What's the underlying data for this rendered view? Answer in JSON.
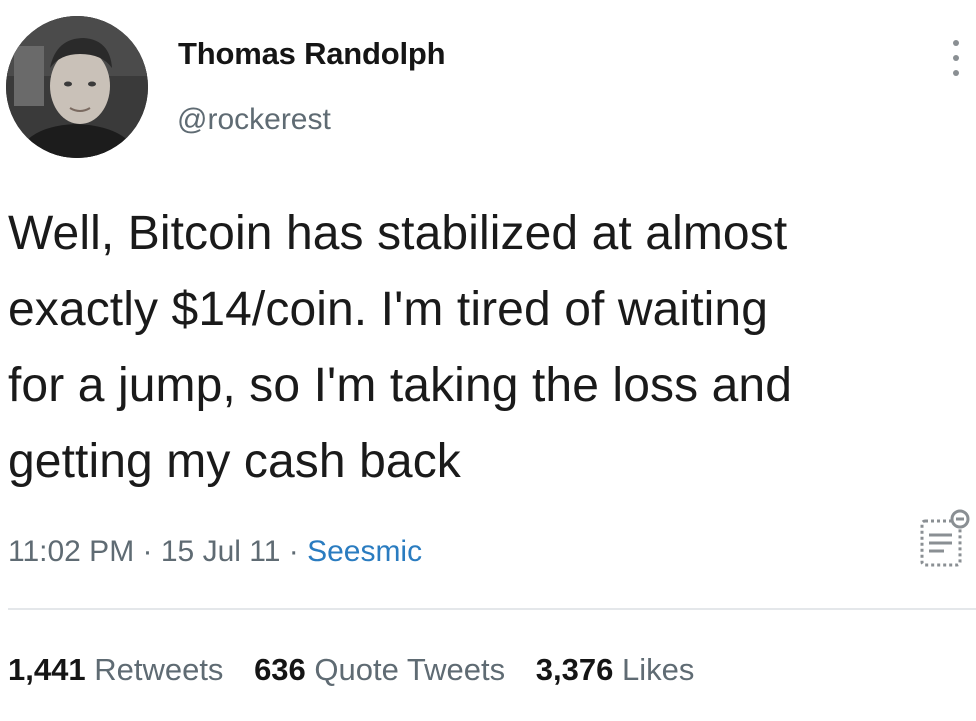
{
  "user": {
    "display_name": "Thomas Randolph",
    "handle": "@rockerest"
  },
  "tweet": {
    "text": "Well, Bitcoin has stabilized at almost\nexactly $14/coin.  I'm tired of waiting\nfor a jump, so I'm taking the loss and\ngetting my cash back",
    "time": "11:02 PM",
    "separator": " · ",
    "date": "15 Jul 11",
    "source": "Seesmic"
  },
  "stats": {
    "retweets_count": "1,441",
    "retweets_label": "Retweets",
    "quotes_count": "636",
    "quotes_label": "Quote Tweets",
    "likes_count": "3,376",
    "likes_label": "Likes"
  },
  "icons": {
    "more": "more-vertical-icon",
    "analytics": "analytics-icon"
  },
  "colors": {
    "link": "#2a7cc0",
    "secondary_text": "#5f6b73",
    "primary_text": "#151515"
  }
}
